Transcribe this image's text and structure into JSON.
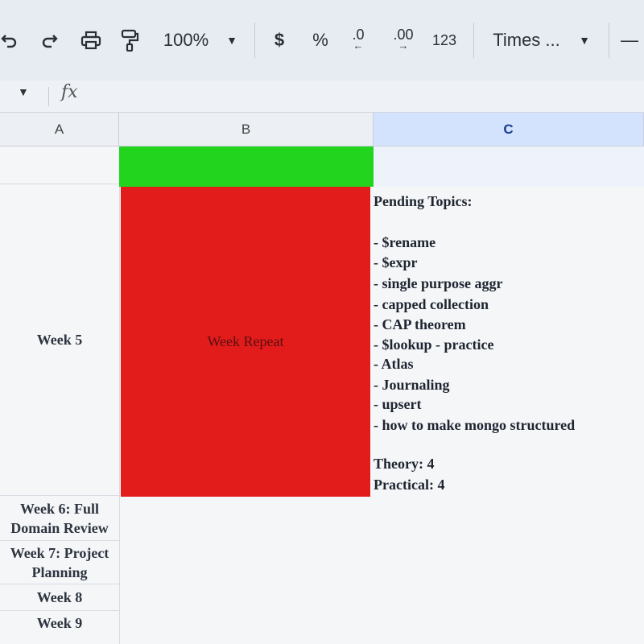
{
  "toolbar": {
    "zoom": "100%",
    "currency": "$",
    "percent": "%",
    "decrease_decimal": ".0",
    "increase_decimal": ".00",
    "number_format": "123",
    "font": "Times ...",
    "minus": "—"
  },
  "formula_bar": {
    "fx": "fx"
  },
  "columns": [
    "A",
    "B",
    "C"
  ],
  "column_a": {
    "week5": "Week 5",
    "week6_line1": "Week 6: Full",
    "week6_line2": "Domain Review",
    "week7_line1": "Week 7: Project",
    "week7_line2": "Planning",
    "week8": "Week 8",
    "week9": "Week 9"
  },
  "column_b": {
    "red_cell_text": "Week Repeat",
    "green_color": "#22d41e",
    "red_color": "#e21b1b"
  },
  "column_c": {
    "heading": "Pending Topics:",
    "topics": [
      "- $rename",
      "- $expr",
      "- single purpose aggr",
      "- capped collection",
      "- CAP theorem",
      "- $lookup - practice",
      "- Atlas",
      "- Journaling",
      "- upsert",
      "- how to make mongo structured"
    ],
    "theory": "Theory: 4",
    "practical": "Practical: 4"
  }
}
